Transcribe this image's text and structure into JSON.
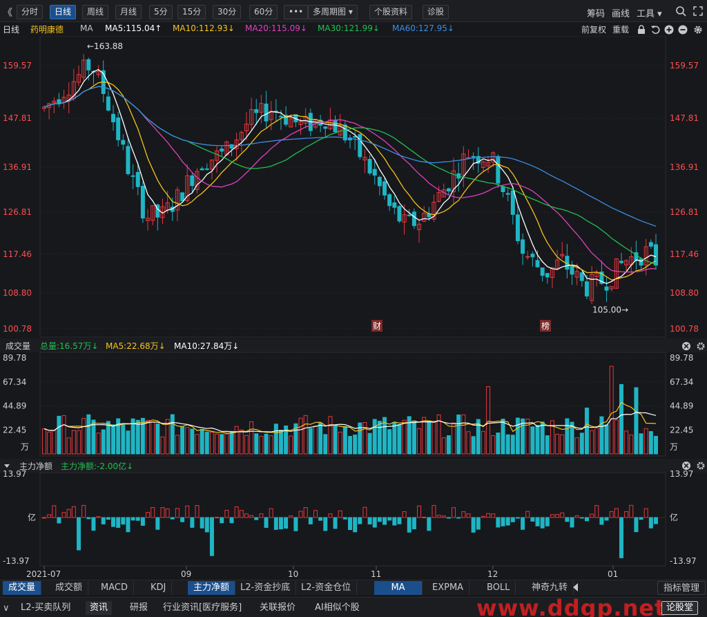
{
  "toolbar": {
    "collapse_label": "《",
    "tabs": [
      "分时",
      "日线",
      "周线",
      "月线",
      "5分",
      "15分",
      "30分",
      "60分",
      "•••",
      "多周期图 ▾",
      "个股资料",
      "诊股"
    ],
    "active_tab": "日线",
    "right_items": [
      "筹码",
      "画线",
      "工具 ▾"
    ]
  },
  "ma_row": {
    "period": "日线",
    "stock_name": "药明康德",
    "ma_label": "MA",
    "ma5": "MA5:115.04↑",
    "ma10": "MA10:112.93↓",
    "ma20": "MA20:115.09↓",
    "ma30": "MA30:121.99↓",
    "ma60": "MA60:127.95↓",
    "fuquan": "前复权",
    "reload": "重载",
    "colors": {
      "ma5": "#ffffff",
      "ma10": "#f5c518",
      "ma20": "#e040c0",
      "ma30": "#20c050",
      "ma60": "#3a8ee6"
    }
  },
  "price_axis": [
    "159.57",
    "147.81",
    "136.91",
    "126.81",
    "117.46",
    "108.80",
    "100.78"
  ],
  "price_annotations": {
    "high": "←163.88",
    "low": "105.00→"
  },
  "event_markers": [
    "财",
    "榜"
  ],
  "volume_panel": {
    "title": "成交量",
    "total": "总量:16.57万↓",
    "ma5": "MA5:22.68万↓",
    "ma10": "MA10:27.84万↓",
    "axis": [
      "89.78",
      "67.34",
      "44.89",
      "22.45",
      "万"
    ]
  },
  "flow_panel": {
    "title": "主力净额",
    "value": "主力净额:-2.00亿↓",
    "axis": [
      "13.97",
      "亿",
      "-13.97"
    ]
  },
  "date_axis": [
    "2021-07",
    "09",
    "10",
    "11",
    "12",
    "01"
  ],
  "indicator_tabs": [
    "成交量",
    "成交额",
    "MACD",
    "KDJ",
    "主力净额",
    "L2-资金抄底",
    "L2-资金仓位"
  ],
  "indicator_active": [
    "成交量",
    "主力净额"
  ],
  "overlay_tabs": [
    "MA",
    "EXPMA",
    "BOLL",
    "神奇九转"
  ],
  "overlay_active": "MA",
  "indicator_manage": "指标管理",
  "bottom_tabs": [
    "L2-买卖队列",
    "资讯",
    "研报",
    "行业资讯[医疗服务]",
    "关联报价",
    "AI相似个股"
  ],
  "bottom_active": "资讯",
  "bottom_right": "论股堂",
  "watermark": "www.ddgp.net",
  "colors": {
    "up": "#e8383d",
    "down": "#1fb5c4",
    "bg": "#17181c",
    "axis_text": "#ff4d4f"
  },
  "chart_data": {
    "type": "candlestick",
    "price_range": [
      100.78,
      163.88
    ],
    "high_mark": 163.88,
    "low_mark": 105.0,
    "ma5_last": 115.04,
    "ma10_last": 112.93,
    "ma20_last": 115.09,
    "ma30_last": 121.99,
    "ma60_last": 127.95,
    "volume_range": [
      0,
      89.78
    ],
    "flow_range": [
      -13.97,
      13.97
    ],
    "volume_last": 16.57,
    "flow_last": -2.0
  }
}
